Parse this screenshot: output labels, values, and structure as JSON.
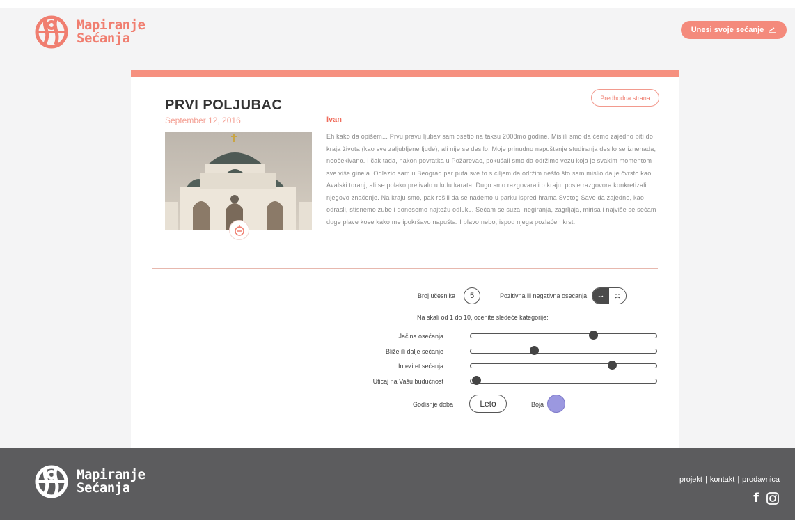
{
  "header": {
    "logo_line1": "Mapiranje",
    "logo_line2": "Sećanja",
    "cta_label": "Unesi svoje sećanje"
  },
  "memory": {
    "back_label": "Predhodna strana",
    "title": "PRVI POLJUBAC",
    "date": "September 12, 2016",
    "author": "Ivan",
    "story": "Eh kako da opišem... Prvu pravu ljubav sam osetio na taksu 2008mo godine. Mislili smo da ćemo zajedno biti do kraja života (kao sve zaljubljene ljude), ali nije se desilo. Moje prinudno napuštanje studiranja desilo se iznenada, neočekivano. I čak tada, nakon povratka u Požarevac, pokušali smo da održimo vezu koja je svakim momentom sve više ginela. Odlazio sam u Beograd par puta sve to s ciljem da održim nešto što sam mislio da je čvrsto kao Avalski toranj, ali se polako prelivalo u kulu karata. Dugo smo razgovarali o kraju, posle razgovora konkretizali njegovo značenje. Na kraju smo, pak rešili da se nađemo u parku ispred hrama Svetog Save da zajedno, kao odrasli, stisnemo zube i donesemo najtežu odluku. Sećam se suza, negiranja, zagrljaja, mirisa i najviše se sećam duge plave kose kako me ipokršavo napušta. I plavo nebo, ispod njega pozlaćen krst."
  },
  "rating": {
    "participants_label": "Broj učesnika",
    "participants_value": "5",
    "feelings_label": "Pozitivna ili negativna osećanja",
    "feelings_positive_icon": "smile-icon",
    "feelings_negative_icon": "frown-icon",
    "feelings_selected": "positive",
    "scale_note": "Na skali od 1 do 10, ocenite sledeće kategorije:",
    "sliders": [
      {
        "label": "Jačina osećanja",
        "value": 0.66
      },
      {
        "label": "Bliže ili dalje sećanje",
        "value": 0.34
      },
      {
        "label": "Intezitet sećanja",
        "value": 0.76
      },
      {
        "label": "Uticaj na Vašu budućnost",
        "value": 0.03
      }
    ],
    "season_label": "Godisnje doba",
    "season_value": "Leto",
    "color_label": "Boja",
    "color_value": "#9b98e0"
  },
  "footer": {
    "logo_line1": "Mapiranje",
    "logo_line2": "Sećanja",
    "link_project": "projekt",
    "link_contact": "kontakt",
    "link_shop": "prodavnica",
    "separator": "|"
  },
  "colors": {
    "accent": "#f48a7c",
    "footer_bg": "#5c5c5e"
  }
}
